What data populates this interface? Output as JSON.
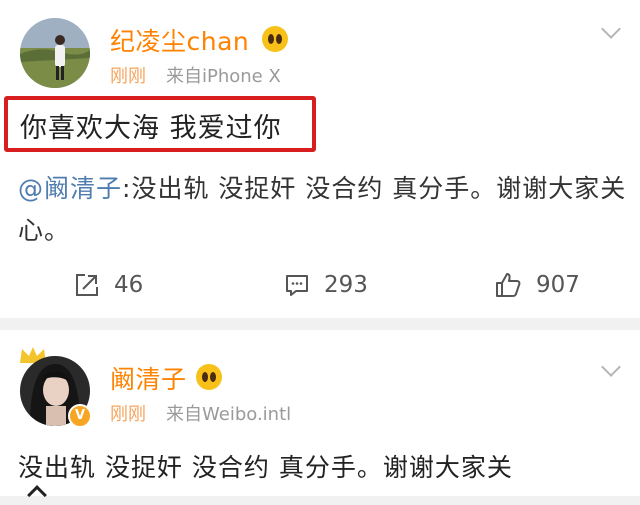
{
  "post1": {
    "username": "纪凌尘chan",
    "time": "刚刚",
    "source": "来自iPhone X",
    "text": "你喜欢大海 我爱过你",
    "repost": {
      "mention": "@阚清子",
      "text": ":没出轨 没捉奸 没合约 真分手。谢谢大家关心。"
    },
    "actions": {
      "repost_count": "46",
      "comment_count": "293",
      "like_count": "907"
    }
  },
  "post2": {
    "username": "阚清子",
    "time": "刚刚",
    "source": "来自Weibo.intl",
    "text": "没出轨 没捉奸 没合约 真分手。谢谢大家关"
  },
  "colors": {
    "username": "#ff8200",
    "mention": "#507daf",
    "highlight_border": "#d71f1f",
    "time": "#f5a45d"
  }
}
